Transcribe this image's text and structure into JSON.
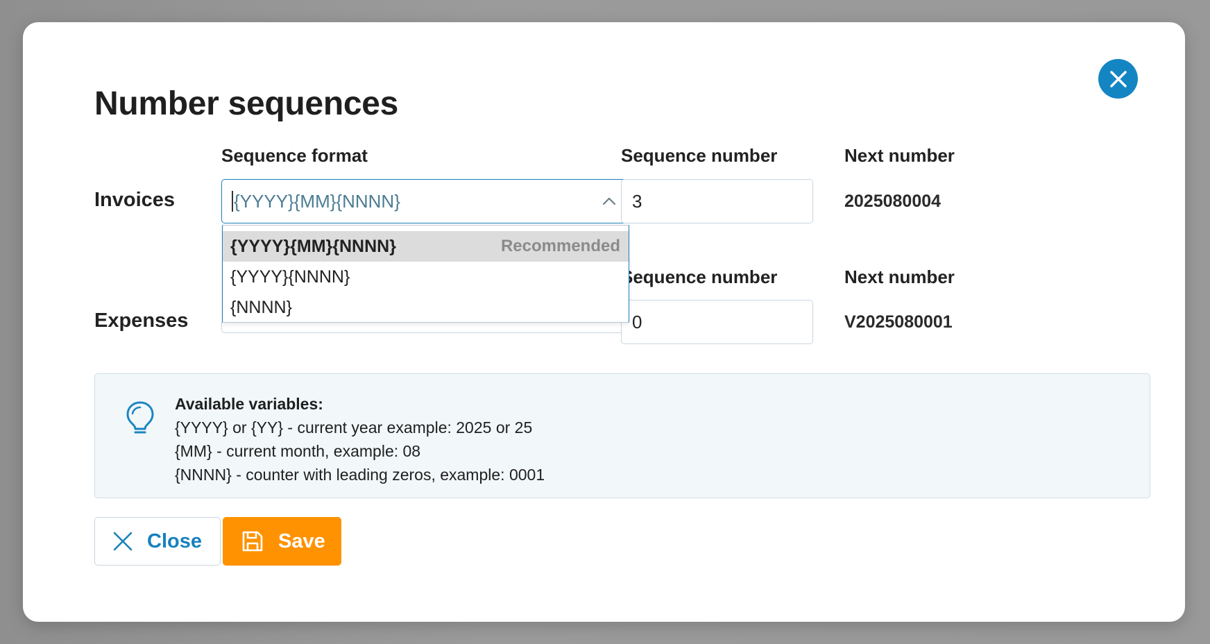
{
  "modal": {
    "title": "Number sequences"
  },
  "columns": {
    "format": "Sequence format",
    "seq_number": "Sequence number",
    "next_number": "Next number"
  },
  "rows": {
    "invoices": {
      "label": "Invoices",
      "format_value": "{YYYY}{MM}{NNNN}",
      "seq_number": "3",
      "next_number": "2025080004"
    },
    "expenses": {
      "label": "Expenses",
      "seq_number": "0",
      "next_number": "V2025080001"
    }
  },
  "dropdown": {
    "options": [
      {
        "label": "{YYYY}{MM}{NNNN}",
        "tag": "Recommended",
        "selected": true
      },
      {
        "label": "{YYYY}{NNNN}"
      },
      {
        "label": "{NNNN}"
      }
    ]
  },
  "info": {
    "heading": "Available variables:",
    "lines": [
      "{YYYY} or {YY} - current year example: 2025 or 25",
      "{MM} - current month, example: 08",
      "{NNNN} - counter with leading zeros, example: 0001"
    ],
    "icon": "lightbulb-icon"
  },
  "buttons": {
    "close": "Close",
    "save": "Save"
  },
  "colors": {
    "accent": "#1385c3",
    "save": "#ff9200",
    "info_bg": "#f2f7fa"
  }
}
